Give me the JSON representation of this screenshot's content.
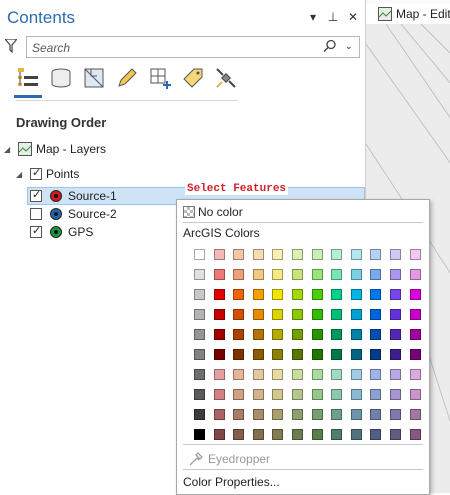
{
  "contents_pane": {
    "title": "Contents",
    "search_placeholder": "Search",
    "section_label": "Drawing Order"
  },
  "tree": {
    "map_label": "Map - Layers",
    "group_label": "Points",
    "layers": [
      {
        "label": "Source-1",
        "checked": true,
        "color": "#d7191c"
      },
      {
        "label": "Source-2",
        "checked": false,
        "color": "#2166ac"
      },
      {
        "label": "GPS",
        "checked": true,
        "color": "#1a9641"
      }
    ]
  },
  "map_tab": {
    "label": "Map - Edit"
  },
  "overlay_text": "Select Features",
  "color_popup": {
    "no_color_label": "No color",
    "palette_label": "ArcGIS Colors",
    "eyedropper_label": "Eyedropper",
    "color_properties_label": "Color Properties...",
    "accent": "#2b6cb0",
    "swatches": [
      [
        "#ffffff",
        "#f4b8b8",
        "#f5c6a5",
        "#f6dcb0",
        "#f7f0b0",
        "#dcf0b0",
        "#c8f0b4",
        "#b4f0d2",
        "#b4e6f0",
        "#b4d2f5",
        "#d2c8f5",
        "#f0c8f0"
      ],
      [
        "#e0e0e0",
        "#f07878",
        "#f0a078",
        "#f4c882",
        "#f5eb82",
        "#c8e678",
        "#96e678",
        "#78e6b4",
        "#78d2e6",
        "#78aaf0",
        "#aa96f0",
        "#e696e6"
      ],
      [
        "#c8c8c8",
        "#e60000",
        "#f06400",
        "#f5a000",
        "#f0e600",
        "#a0dc00",
        "#46d200",
        "#00d28c",
        "#00b4e6",
        "#0078f0",
        "#7846f0",
        "#dc00dc"
      ],
      [
        "#b4b4b4",
        "#c80000",
        "#d25000",
        "#e68c00",
        "#dcd200",
        "#8cc800",
        "#32be00",
        "#00be78",
        "#00a0d2",
        "#0064dc",
        "#6432dc",
        "#c800c8"
      ],
      [
        "#969696",
        "#a00000",
        "#aa4100",
        "#b47300",
        "#b4aa00",
        "#73a000",
        "#289600",
        "#009664",
        "#0082aa",
        "#0050b4",
        "#5028b4",
        "#a000a0"
      ],
      [
        "#828282",
        "#780000",
        "#7d3200",
        "#8c5a00",
        "#8c8200",
        "#5a7800",
        "#1e7800",
        "#00784b",
        "#006482",
        "#003c8c",
        "#3c1e8c",
        "#780078"
      ],
      [
        "#6e6e6e",
        "#e6a0a0",
        "#e6b496",
        "#e6c8a0",
        "#e6dca0",
        "#c8dca0",
        "#aadca0",
        "#a0dcc3",
        "#a0cde6",
        "#a0b4e6",
        "#b9aae6",
        "#dcaadc"
      ],
      [
        "#5a5a5a",
        "#d28282",
        "#d2a082",
        "#d2b48c",
        "#d2c88c",
        "#b4c88c",
        "#96c88c",
        "#8cc8af",
        "#8cb9d2",
        "#8ca0d2",
        "#a596d2",
        "#c896c8"
      ],
      [
        "#3c3c3c",
        "#aa6464",
        "#aa7d64",
        "#aa8c6e",
        "#aaa06e",
        "#8ca06e",
        "#78a06e",
        "#6ea08c",
        "#6e96aa",
        "#6e82aa",
        "#8278aa",
        "#a078a0"
      ],
      [
        "#000000",
        "#824646",
        "#825f46",
        "#826e50",
        "#827d50",
        "#6e7d50",
        "#5a7d50",
        "#507d6e",
        "#507382",
        "#505f82",
        "#645a82",
        "#825a82"
      ]
    ]
  }
}
